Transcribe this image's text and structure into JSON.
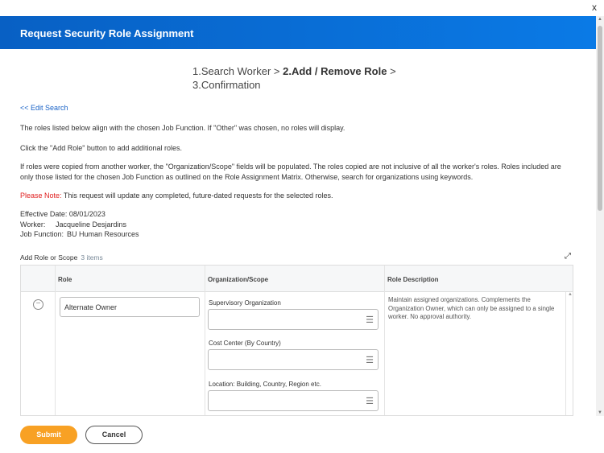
{
  "window": {
    "close_label": "x"
  },
  "header": {
    "title": "Request Security Role Assignment"
  },
  "steps": {
    "step1": "1.Search Worker >",
    "step2": "2.Add / Remove Role",
    "sep": ">",
    "step3": "3.Confirmation"
  },
  "edit_search": "<< Edit Search",
  "paragraphs": [
    "The roles listed below align with the chosen Job Function. If \"Other\" was chosen, no roles will display.",
    "Click the \"Add Role\" button to add additional roles.",
    "If roles were copied from another worker, the \"Organization/Scope\" fields will be populated. The roles copied are not inclusive of all the worker's roles. Roles included are only those listed for the chosen Job Function as outlined on the Role Assignment Matrix. Otherwise, search for organizations using keywords."
  ],
  "note": {
    "label": "Please Note:",
    "text": " This request will update any completed, future-dated requests for the selected roles."
  },
  "details": {
    "effective_date": "Effective Date: 08/01/2023",
    "worker_label": "Worker:",
    "worker": "Jacqueline Desjardins",
    "job_function_label": "Job Function:",
    "job_function": "BU Human Resources"
  },
  "section": {
    "title": "Add Role or Scope",
    "count": "3 items"
  },
  "table": {
    "headers": [
      "Role",
      "Organization/Scope",
      "Role Description"
    ],
    "rows": [
      {
        "role": "Alternate Owner",
        "scope_fields": [
          "Supervisory Organization",
          "Cost Center (By Country)",
          "Location: Building, Country, Region etc."
        ],
        "description": "Maintain assigned organizations.  Complements the Organization Owner, which can only be assigned to a single worker.  No approval authority."
      }
    ]
  },
  "footer": {
    "submit": "Submit",
    "cancel": "Cancel"
  },
  "colors": {
    "header": "#0a6ed8",
    "submit": "#f8a124",
    "note": "#e02020",
    "link": "#1a63c7"
  }
}
